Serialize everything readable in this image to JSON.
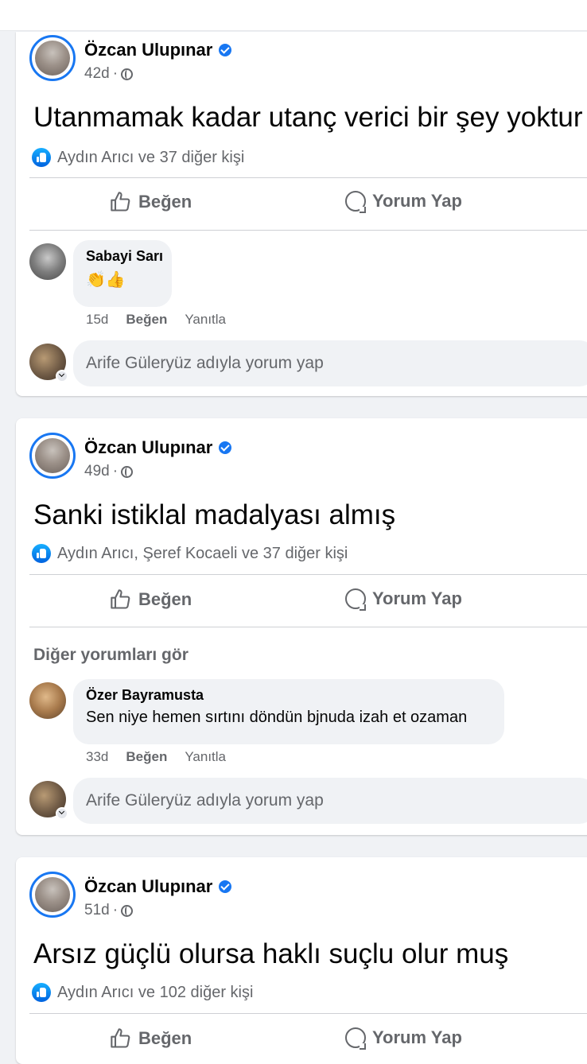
{
  "posts": [
    {
      "author": "Özcan Ulupınar",
      "time": "42d",
      "separator": "·",
      "text": "Utanmamak kadar utanç verici bir şey yoktur",
      "reactions": "Aydın Arıcı ve 37 diğer kişi",
      "like_label": "Beğen",
      "comment_label": "Yorum Yap",
      "comment": {
        "name": "Sabayi Sarı",
        "text": "👏👍",
        "time": "15d",
        "like": "Beğen",
        "reply": "Yanıtla"
      },
      "write_placeholder": "Arife Güleryüz adıyla yorum yap"
    },
    {
      "author": "Özcan Ulupınar",
      "time": "49d",
      "separator": "·",
      "text": "Sanki istiklal madalyası almış",
      "reactions": "Aydın Arıcı, Şeref Kocaeli ve 37 diğer kişi",
      "like_label": "Beğen",
      "comment_label": "Yorum Yap",
      "see_more": "Diğer yorumları gör",
      "comment": {
        "name": "Özer Bayramusta",
        "text": "Sen niye hemen sırtını döndün bjnuda izah et ozaman",
        "time": "33d",
        "like": "Beğen",
        "reply": "Yanıtla"
      },
      "write_placeholder": "Arife Güleryüz adıyla yorum yap"
    },
    {
      "author": "Özcan Ulupınar",
      "time": "51d",
      "separator": "·",
      "text": "Arsız güçlü olursa haklı suçlu olur muş",
      "reactions": "Aydın Arıcı ve 102 diğer kişi",
      "like_label": "Beğen",
      "comment_label": "Yorum Yap"
    }
  ],
  "colors": {
    "accent": "#1877f2",
    "secondary_text": "#65676b",
    "background": "#f0f2f5"
  },
  "icons": {
    "verified": "verified-badge-icon",
    "audience": "globe-icon",
    "like": "thumbs-up-icon",
    "comment": "speech-bubble-icon"
  }
}
